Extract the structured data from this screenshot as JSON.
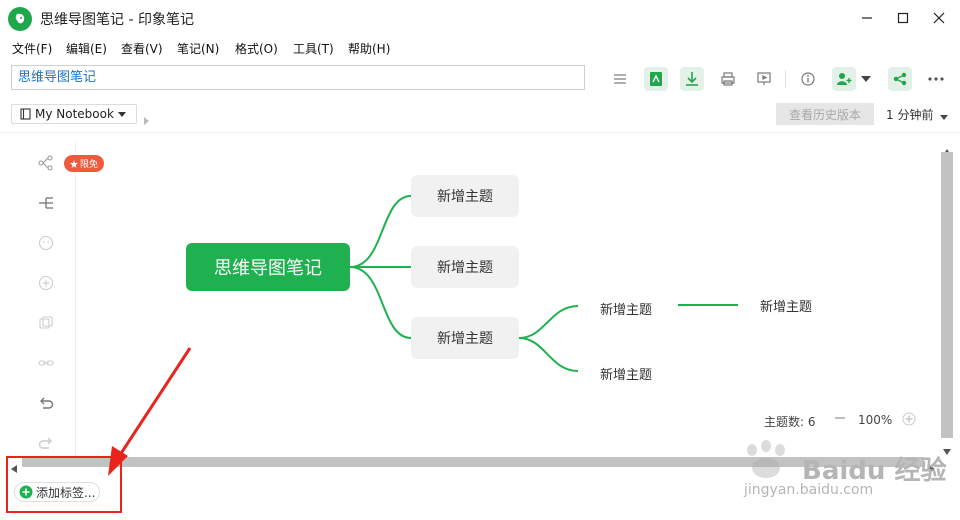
{
  "window": {
    "title": "思维导图笔记 - 印象笔记"
  },
  "menu": [
    "文件(F)",
    "编辑(E)",
    "查看(V)",
    "笔记(N)",
    "格式(O)",
    "工具(T)",
    "帮助(H)"
  ],
  "note": {
    "title_value": "思维导图笔记"
  },
  "notebook": {
    "name": "My Notebook"
  },
  "history": {
    "button_label": "查看历史版本",
    "saved_time": "1 分钟前"
  },
  "badge": {
    "label": "限免"
  },
  "mindmap": {
    "root": "思维导图笔记",
    "branches": [
      "新增主题",
      "新增主题",
      "新增主题"
    ],
    "sub_branches": [
      "新增主题",
      "新增主题"
    ],
    "sub_sub_branch": "新增主题"
  },
  "status": {
    "topic_count_label": "主题数: 6",
    "zoom": "100%"
  },
  "tags": {
    "add_label": "添加标签..."
  },
  "watermark": {
    "brand": "Baidu 经验",
    "url": "jingyan.baidu.com"
  },
  "colors": {
    "brand_green": "#1fb14f",
    "annotation_red": "#e8241c"
  }
}
